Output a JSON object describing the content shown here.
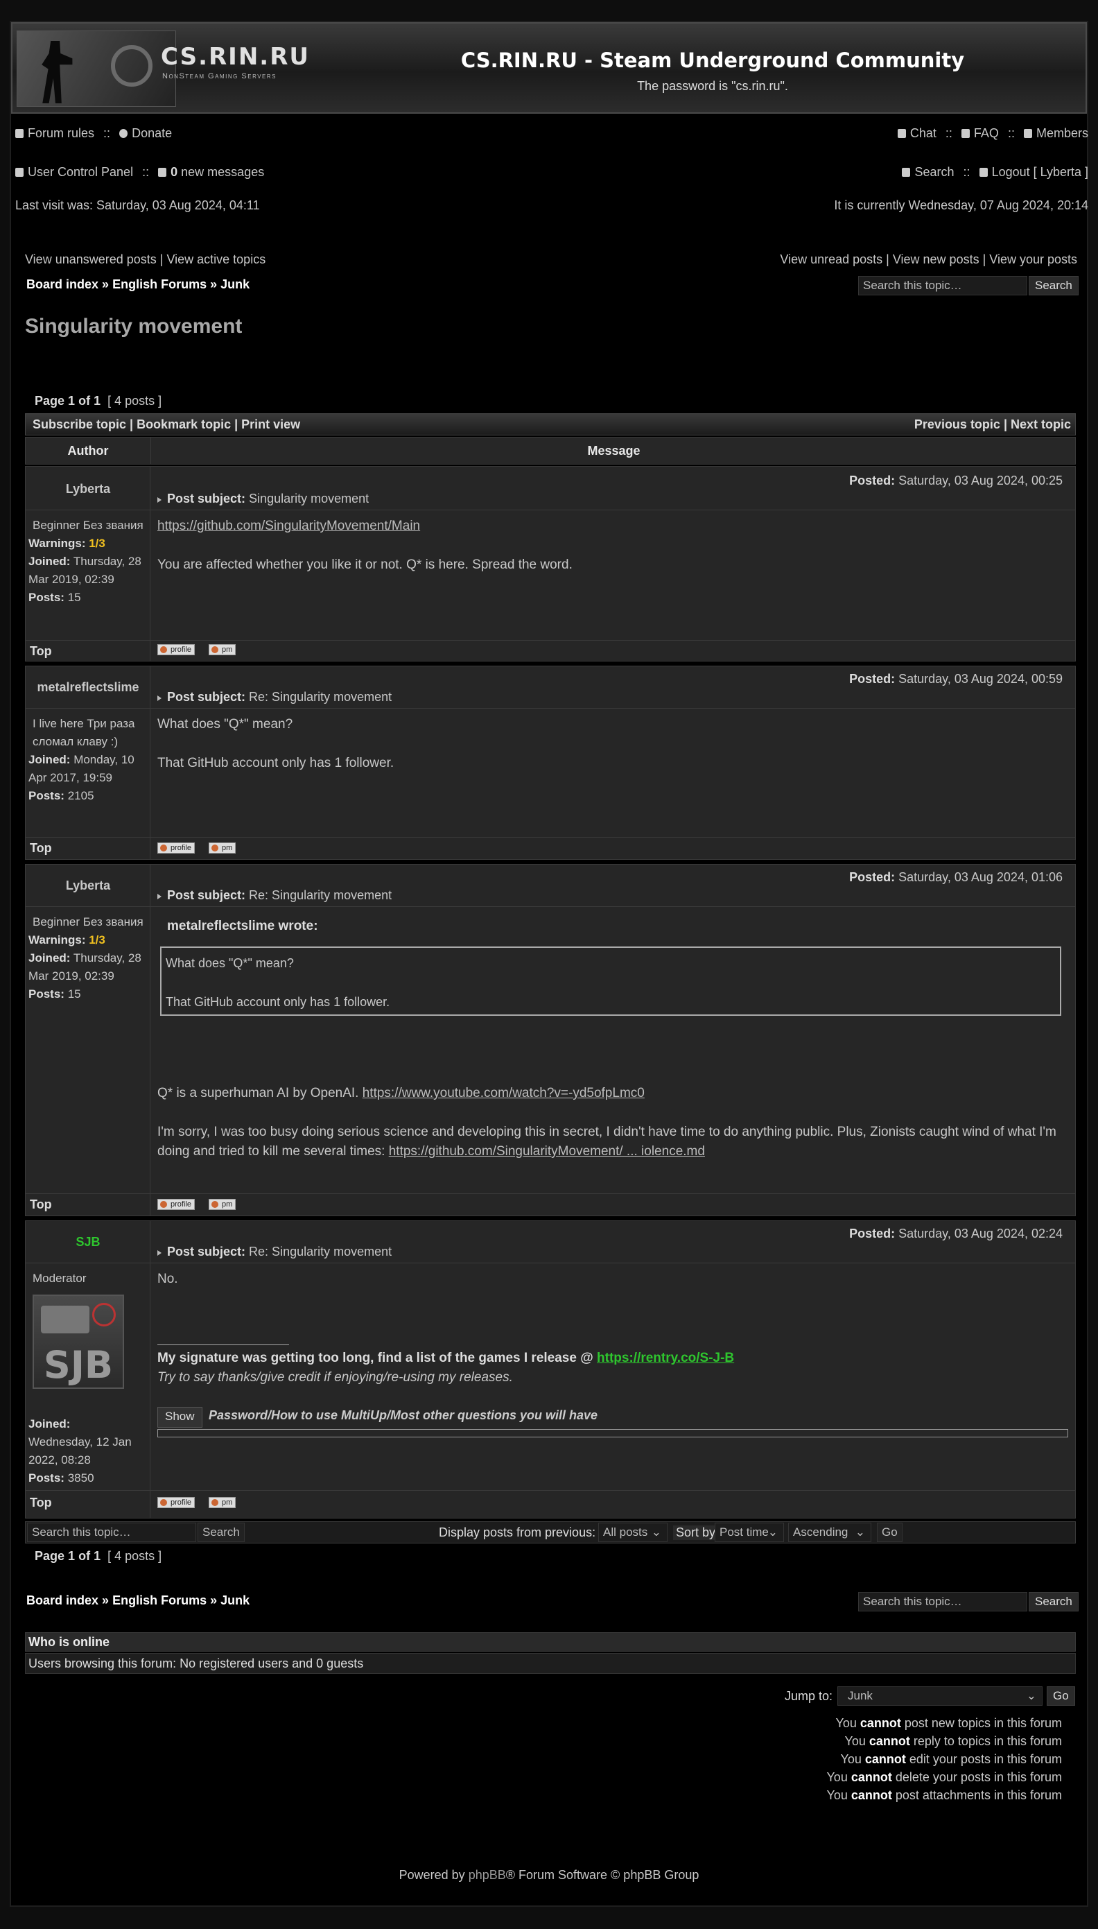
{
  "header": {
    "logo_text": "CS.RIN.RU",
    "logo_sub": "NonSteam Gaming Servers",
    "title": "CS.RIN.RU - Steam Underground Community",
    "description": "The password is \"cs.rin.ru\"."
  },
  "nav1": {
    "forum_rules": "Forum rules",
    "donate": "Donate",
    "chat": "Chat",
    "faq": "FAQ",
    "members": "Members",
    "sep": "::"
  },
  "nav2": {
    "ucp": "User Control Panel",
    "new_count": "0",
    "new_messages": "new messages",
    "search": "Search",
    "logout": "Logout [ Lyberta ]"
  },
  "visit": {
    "last": "Last visit was: Saturday, 03 Aug 2024, 04:11",
    "current": "It is currently Wednesday, 07 Aug 2024, 20:14"
  },
  "links": {
    "left": "View unanswered posts | View active topics",
    "right": "View unread posts | View new posts | View your posts"
  },
  "breadcrumb": {
    "board": "Board index",
    "forum": "English Forums",
    "sub": "Junk",
    "sep": "»"
  },
  "topic_search": {
    "placeholder": "Search this topic…",
    "button": "Search"
  },
  "topic": {
    "title": "Singularity movement",
    "page_label": "Page",
    "page_current": "1",
    "page_of": "of",
    "page_total": "1",
    "posts_info": "[ 4 posts ]"
  },
  "topic_bar": {
    "left": "Subscribe topic | Bookmark topic | Print view",
    "right": "Previous topic | Next topic"
  },
  "table_header": {
    "author": "Author",
    "message": "Message"
  },
  "labels": {
    "posted": "Posted:",
    "subject": "Post subject:",
    "warnings": "Warnings:",
    "joined": "Joined:",
    "posts": "Posts:",
    "top": "Top",
    "profile": "profile",
    "pm": "pm"
  },
  "posts": [
    {
      "author": "Lyberta",
      "rank": "Beginner Без звания",
      "warnings": "1/3",
      "joined": "Thursday, 28 Mar 2019, 02:39",
      "posts": "15",
      "posted": "Saturday, 03 Aug 2024, 00:25",
      "subject": "Singularity movement",
      "link": "https://github.com/SingularityMovement/Main",
      "text": "You are affected whether you like it or not. Q* is here. Spread the word."
    },
    {
      "author": "metalreflectslime",
      "rank": "I live here Три раза сломал клаву :)",
      "joined": "Monday, 10 Apr 2017, 19:59",
      "posts": "2105",
      "posted": "Saturday, 03 Aug 2024, 00:59",
      "subject": "Re: Singularity movement",
      "line1": "What does \"Q*\" mean?",
      "line2": "That GitHub account only has 1 follower."
    },
    {
      "author": "Lyberta",
      "rank": "Beginner Без звания",
      "warnings": "1/3",
      "joined": "Thursday, 28 Mar 2019, 02:39",
      "posts": "15",
      "posted": "Saturday, 03 Aug 2024, 01:06",
      "subject": "Re: Singularity movement",
      "quote_author": "metalreflectslime wrote:",
      "quote_line1": "What does \"Q*\" mean?",
      "quote_line2": "That GitHub account only has 1 follower.",
      "text1": "Q* is a superhuman AI by OpenAI.",
      "link1": "https://www.youtube.com/watch?v=-yd5ofpLmc0",
      "text2": "I'm sorry, I was too busy doing serious science and developing this in secret, I didn't have time to do anything public. Plus, Zionists caught wind of what I'm doing and tried to kill me several times:",
      "link2": "https://github.com/SingularityMovement/ ... iolence.md"
    },
    {
      "author": "SJB",
      "rank": "Moderator",
      "avatar_text": "SJB",
      "joined": "Wednesday, 12 Jan 2022, 08:28",
      "posts": "3850",
      "posted": "Saturday, 03 Aug 2024, 02:24",
      "subject": "Re: Singularity movement",
      "text": "No.",
      "sig_text": "My signature was getting too long, find a list of the games I release @",
      "sig_link": "https://rentry.co/S-J-B",
      "sig_italic": "Try to say thanks/give credit if enjoying/re-using my releases.",
      "spoiler_button": "Show",
      "spoiler_title": "Password/How to use MultiUp/Most other questions you will have"
    }
  ],
  "bottom_bar": {
    "search_placeholder": "Search this topic…",
    "search_button": "Search",
    "display_label": "Display posts from previous:",
    "display_value": "All posts",
    "sort_label": "Sort by",
    "sort_value": "Post time",
    "order_value": "Ascending",
    "go": "Go"
  },
  "online": {
    "title": "Who is online",
    "text": "Users browsing this forum: No registered users and 0 guests"
  },
  "jump": {
    "label": "Jump to:",
    "value": "Junk",
    "go": "Go"
  },
  "permissions": [
    {
      "pre": "You",
      "bold": "cannot",
      "post": "post new topics in this forum"
    },
    {
      "pre": "You",
      "bold": "cannot",
      "post": "reply to topics in this forum"
    },
    {
      "pre": "You",
      "bold": "cannot",
      "post": "edit your posts in this forum"
    },
    {
      "pre": "You",
      "bold": "cannot",
      "post": "delete your posts in this forum"
    },
    {
      "pre": "You",
      "bold": "cannot",
      "post": "post attachments in this forum"
    }
  ],
  "footer": {
    "pre": "Powered by",
    "link": "phpBB",
    "post": "® Forum Software © phpBB Group"
  },
  "colors": {
    "moderator": "#2ec62e",
    "link_green": "#2ec62e",
    "warning": "#f0c020",
    "footer_link": "#999999"
  }
}
